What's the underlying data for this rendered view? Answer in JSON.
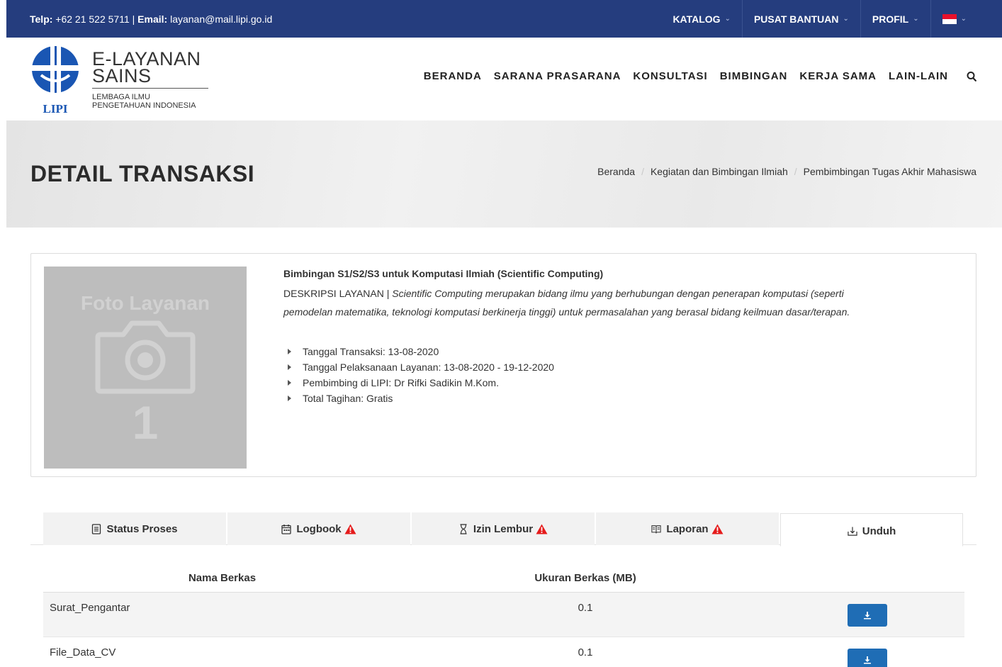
{
  "topbar": {
    "phone_label": "Telp:",
    "phone": "+62 21 522 5711",
    "separator": "|",
    "email_label": "Email:",
    "email": "layanan@mail.lipi.go.id",
    "menus": [
      "KATALOG",
      "PUSAT BANTUAN",
      "PROFIL"
    ]
  },
  "logo": {
    "title_line1": "E-LAYANAN",
    "title_line2": "SAINS",
    "subtitle_line1": "LEMBAGA ILMU",
    "subtitle_line2": "PENGETAHUAN INDONESIA",
    "mark_text": "LIPI"
  },
  "nav": {
    "items": [
      "BERANDA",
      "SARANA PRASARANA",
      "KONSULTASI",
      "BIMBINGAN",
      "KERJA SAMA",
      "LAIN-LAIN"
    ]
  },
  "page": {
    "title": "DETAIL TRANSAKSI",
    "breadcrumb": [
      "Beranda",
      "Kegiatan dan Bimbingan Ilmiah",
      "Pembimbingan Tugas Akhir Mahasiswa"
    ]
  },
  "service": {
    "photo_label": "Foto Layanan",
    "photo_number": "1",
    "title": "Bimbingan S1/S2/S3 untuk Komputasi Ilmiah (Scientific Computing)",
    "desc_label": "DESKRIPSI LAYANAN |",
    "desc_line1": "Scientific Computing merupakan bidang ilmu yang berhubungan dengan penerapan komputasi (seperti",
    "desc_line2": "pemodelan matematika, teknologi komputasi berkinerja tinggi) untuk permasalahan yang berasal bidang keilmuan dasar/terapan.",
    "details": [
      "Tanggal Transaksi: 13-08-2020",
      "Tanggal Pelaksanaan Layanan: 13-08-2020 - 19-12-2020",
      "Pembimbing di LIPI: Dr Rifki Sadikin M.Kom.",
      "Total Tagihan: Gratis"
    ]
  },
  "tabs": [
    {
      "label": "Status Proses",
      "icon": "document-icon",
      "warning": false
    },
    {
      "label": "Logbook",
      "icon": "calendar-icon",
      "warning": true
    },
    {
      "label": "Izin Lembur",
      "icon": "hourglass-icon",
      "warning": true
    },
    {
      "label": "Laporan",
      "icon": "book-icon",
      "warning": true
    },
    {
      "label": "Unduh",
      "icon": "download-tray-icon",
      "warning": false,
      "active": true
    }
  ],
  "files": {
    "col_name": "Nama Berkas",
    "col_size": "Ukuran Berkas (MB)",
    "rows": [
      {
        "name": "Surat_Pengantar",
        "size": "0.1"
      },
      {
        "name": "File_Data_CV",
        "size": "0.1"
      }
    ]
  },
  "colors": {
    "topbar": "#253d7e",
    "logo_blue": "#1a56b3",
    "warning": "#e51b1b",
    "download_button": "#1f6db5"
  }
}
